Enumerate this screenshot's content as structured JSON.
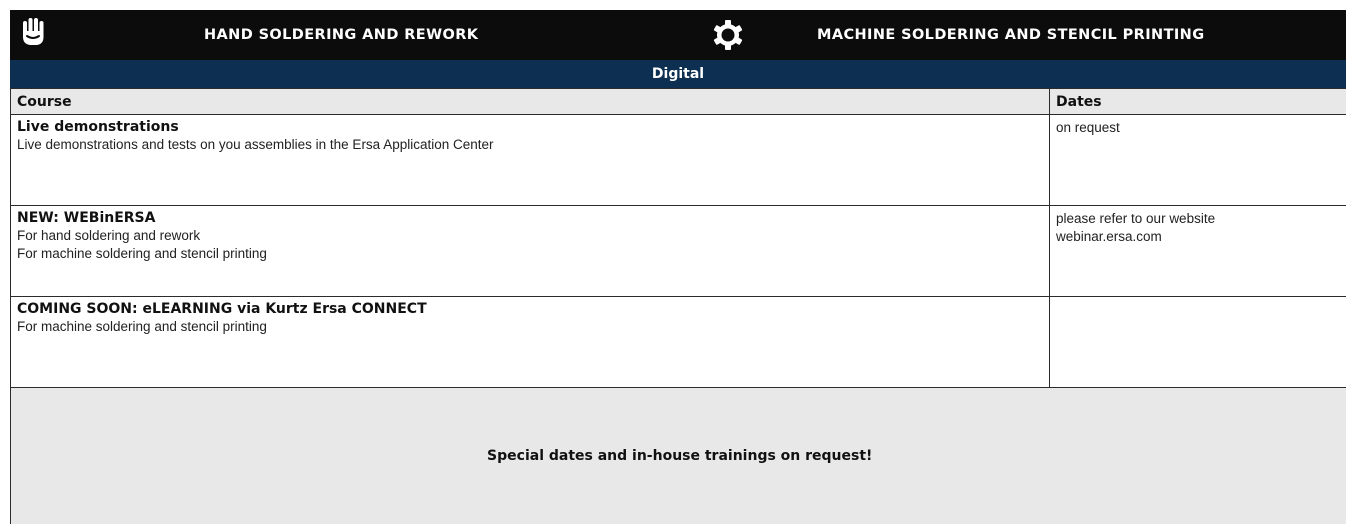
{
  "header": {
    "hand_icon": "hand-icon",
    "hand_title": "HAND SOLDERING AND REWORK",
    "gear_icon": "gear-icon",
    "machine_title": "MACHINE SOLDERING AND STENCIL PRINTING"
  },
  "section": {
    "title": "Digital"
  },
  "table": {
    "columns": [
      "Course",
      "Dates"
    ],
    "rows": [
      {
        "title": "Live demonstrations",
        "lines": [
          "Live demonstrations and tests on you assemblies in the Ersa Application Center"
        ],
        "dates": [
          "on request"
        ]
      },
      {
        "title": "NEW: WEBinERSA",
        "lines": [
          "For hand soldering and rework",
          "For machine soldering and stencil printing"
        ],
        "dates": [
          "please refer to our website",
          "webinar.ersa.com"
        ]
      },
      {
        "title": "COMING SOON: eLEARNING via Kurtz Ersa CONNECT",
        "lines": [
          "For machine soldering and stencil printing"
        ],
        "dates": []
      }
    ],
    "footer": "Special dates and in-house trainings on request!"
  },
  "colors": {
    "header_bg": "#0c0c0c",
    "section_bg": "#0d2f52",
    "table_header_bg": "#e8e8e8"
  }
}
